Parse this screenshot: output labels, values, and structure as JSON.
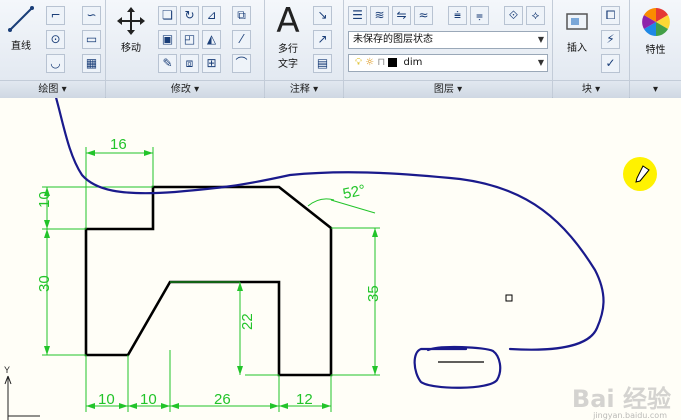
{
  "ribbon": {
    "draw": {
      "line_label": "直线",
      "panel_label": "绘图"
    },
    "modify": {
      "move_label": "移动",
      "panel_label": "修改"
    },
    "annotate": {
      "mtext_label_1": "多行",
      "mtext_label_2": "文字",
      "mtext_glyph": "A",
      "panel_label": "注释"
    },
    "layers": {
      "state_value": "未保存的图层状态",
      "current_layer": "dim",
      "panel_label": "图层"
    },
    "block": {
      "insert_label": "插入",
      "panel_label": "块"
    },
    "properties": {
      "label": "特性"
    }
  },
  "drawing": {
    "dimensions": {
      "top_width": "16",
      "left_top": "10",
      "left_main": "30",
      "inner_height": "22",
      "right_height": "35",
      "angle": "52°",
      "bottom_1": "10",
      "bottom_2": "10",
      "bottom_3": "26",
      "bottom_4": "12"
    },
    "ucs_label": "Y"
  },
  "watermark": {
    "text": "Bai 经验",
    "url": "jingyan.baidu.com"
  },
  "colors": {
    "dimension": "#22c42a",
    "ink": "#1a1a8c",
    "highlight": "#fff200",
    "outline": "#000000"
  }
}
